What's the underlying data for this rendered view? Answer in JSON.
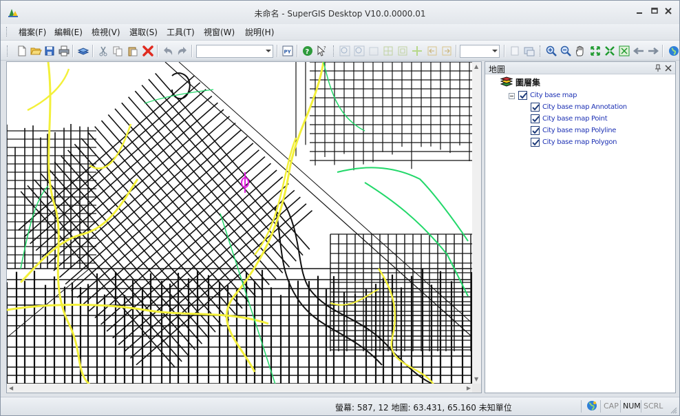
{
  "window": {
    "title": "未命名 - SuperGIS Desktop V10.0.0000.01"
  },
  "menu": {
    "items": [
      "檔案(F)",
      "編輯(E)",
      "檢視(V)",
      "選取(S)",
      "工具(T)",
      "視窗(W)",
      "說明(H)"
    ]
  },
  "toolbar": {
    "scale_combo_value": "",
    "zoom_combo_value": "",
    "icons": [
      "new-document-icon",
      "open-folder-icon",
      "save-icon",
      "print-icon",
      "add-layer-icon",
      "cut-icon",
      "copy-icon",
      "paste-icon",
      "delete-icon",
      "undo-icon",
      "redo-icon",
      "python-icon",
      "help-icon",
      "select-pointer-icon",
      "zoom-in-icon",
      "zoom-out-icon",
      "pan-icon",
      "full-extent-icon",
      "previous-extent-icon",
      "next-extent-icon"
    ]
  },
  "panel": {
    "title": "地圖",
    "root_label": "圖層集",
    "group_label": "City base map",
    "layers": [
      "City base map Annotation",
      "City base map Point",
      "City base map Polyline",
      "City base map Polygon"
    ]
  },
  "status": {
    "coordinates": "螢幕: 587, 12  地圖: 63.431, 65.160 未知單位",
    "cap": "CAP",
    "num": "NUM",
    "scrl": "SCRL"
  },
  "colors": {
    "road_yellow": "#f3f03a",
    "road_black": "#111111",
    "river_green": "#23d86a",
    "marker_magenta": "#e020e0",
    "layer_label_blue": "#1e32b4"
  }
}
